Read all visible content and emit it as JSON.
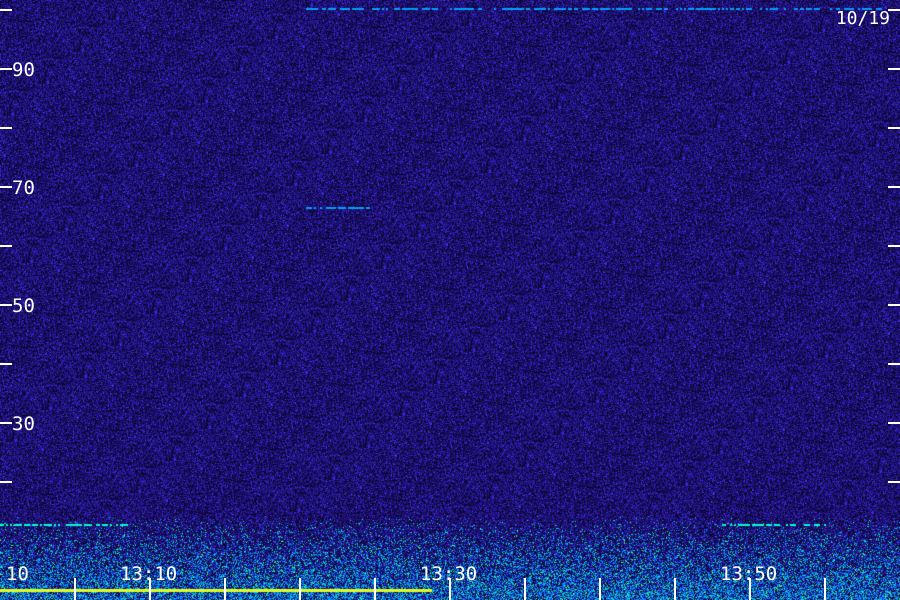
{
  "chart_data": {
    "type": "heatmap",
    "date_label": "10/19",
    "y_tick_values": [
      20,
      30,
      40,
      50,
      60,
      70,
      80,
      90,
      100
    ],
    "y_labels": [
      {
        "value": 30,
        "text": "30"
      },
      {
        "value": 50,
        "text": "50"
      },
      {
        "value": 70,
        "text": "70"
      },
      {
        "value": 90,
        "text": "90"
      }
    ],
    "ylim": [
      0,
      102
    ],
    "x_labels": [
      "10",
      "13:10",
      "13:30",
      "13:50"
    ],
    "x_tick_count": 12,
    "colors": {
      "background": "#000000",
      "noise_low": "#140a3c",
      "noise_mid": "#2d1ea0",
      "noise_high": "#4632dc",
      "band": "#00a0ff",
      "band_hot": "#00ffd0",
      "signal": "#e0ff20",
      "axis": "#ffffff"
    },
    "features": [
      {
        "kind": "trace",
        "value": 1.8,
        "from_frac": 0.0,
        "to_frac": 0.48,
        "color": "signal"
      },
      {
        "kind": "trace",
        "value": 100.4,
        "from_frac": 0.34,
        "to_frac": 0.98,
        "color": "band"
      },
      {
        "kind": "trace",
        "value": 66.6,
        "from_frac": 0.34,
        "to_frac": 0.41,
        "color": "band"
      },
      {
        "kind": "trace",
        "value": 12.8,
        "from_frac": 0.0,
        "to_frac": 0.14,
        "color": "band_hot"
      },
      {
        "kind": "trace",
        "value": 12.8,
        "from_frac": 0.8,
        "to_frac": 0.92,
        "color": "band_hot"
      }
    ]
  }
}
